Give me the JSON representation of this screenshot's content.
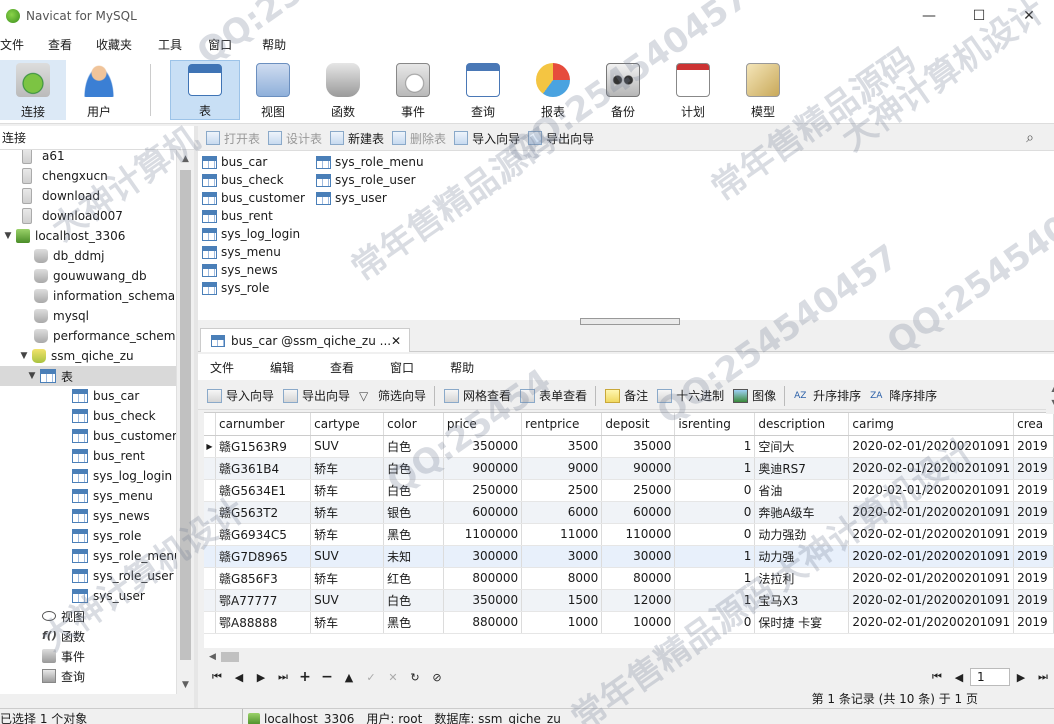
{
  "window": {
    "title": "Navicat for MySQL",
    "controls": [
      "—",
      "☐",
      "✕"
    ]
  },
  "menubar": [
    "文件",
    "查看",
    "收藏夹",
    "工具",
    "窗口",
    "帮助"
  ],
  "toolbar": [
    {
      "label": "连接",
      "icon": "plug-icon"
    },
    {
      "label": "用户",
      "icon": "user-icon"
    },
    {
      "label": "表",
      "icon": "table-icon",
      "active": true
    },
    {
      "label": "视图",
      "icon": "glasses-icon"
    },
    {
      "label": "函数",
      "icon": "function-icon"
    },
    {
      "label": "事件",
      "icon": "clock-icon"
    },
    {
      "label": "查询",
      "icon": "query-icon"
    },
    {
      "label": "报表",
      "icon": "report-icon"
    },
    {
      "label": "备份",
      "icon": "backup-icon"
    },
    {
      "label": "计划",
      "icon": "calendar-icon"
    },
    {
      "label": "模型",
      "icon": "model-icon"
    }
  ],
  "left_panel": {
    "header": "连接",
    "tree": [
      {
        "label": "a61",
        "level": 0,
        "type": "db-plain"
      },
      {
        "label": "chengxucn",
        "level": 0,
        "type": "db-plain"
      },
      {
        "label": "download",
        "level": 0,
        "type": "db-plain"
      },
      {
        "label": "download007",
        "level": 0,
        "type": "db-plain"
      },
      {
        "label": "localhost_3306",
        "level": 0,
        "type": "conn",
        "expander": "▼"
      },
      {
        "label": "db_ddmj",
        "level": 1,
        "type": "db"
      },
      {
        "label": "gouwuwang_db",
        "level": 1,
        "type": "db"
      },
      {
        "label": "information_schema",
        "level": 1,
        "type": "db"
      },
      {
        "label": "mysql",
        "level": 1,
        "type": "db"
      },
      {
        "label": "performance_schema",
        "level": 1,
        "type": "db"
      },
      {
        "label": "ssm_qiche_zu",
        "level": 1,
        "type": "db-open",
        "expander": "▼"
      },
      {
        "label": "表",
        "level": 2,
        "type": "tbl",
        "expander": "▼",
        "selected": true
      },
      {
        "label": "bus_car",
        "level": 3,
        "type": "tbl"
      },
      {
        "label": "bus_check",
        "level": 3,
        "type": "tbl"
      },
      {
        "label": "bus_customer",
        "level": 3,
        "type": "tbl"
      },
      {
        "label": "bus_rent",
        "level": 3,
        "type": "tbl"
      },
      {
        "label": "sys_log_login",
        "level": 3,
        "type": "tbl"
      },
      {
        "label": "sys_menu",
        "level": 3,
        "type": "tbl"
      },
      {
        "label": "sys_news",
        "level": 3,
        "type": "tbl"
      },
      {
        "label": "sys_role",
        "level": 3,
        "type": "tbl"
      },
      {
        "label": "sys_role_menu",
        "level": 3,
        "type": "tbl"
      },
      {
        "label": "sys_role_user",
        "level": 3,
        "type": "tbl"
      },
      {
        "label": "sys_user",
        "level": 3,
        "type": "tbl"
      },
      {
        "label": "视图",
        "level": 2,
        "type": "view"
      },
      {
        "label": "函数",
        "level": 2,
        "type": "fn",
        "glyph": "f()"
      },
      {
        "label": "事件",
        "level": 2,
        "type": "evt"
      },
      {
        "label": "查询",
        "level": 2,
        "type": "qry"
      }
    ]
  },
  "object_toolbar": [
    {
      "label": "打开表",
      "disabled": true
    },
    {
      "label": "设计表",
      "disabled": true
    },
    {
      "label": "新建表",
      "disabled": false
    },
    {
      "label": "删除表",
      "disabled": true
    },
    {
      "label": "导入向导",
      "disabled": false
    },
    {
      "label": "导出向导",
      "disabled": false
    }
  ],
  "object_list": {
    "col1": [
      "bus_car",
      "bus_check",
      "bus_customer",
      "bus_rent",
      "sys_log_login",
      "sys_menu",
      "sys_news",
      "sys_role"
    ],
    "col2": [
      "sys_role_menu",
      "sys_role_user",
      "sys_user"
    ]
  },
  "doc_tab": {
    "label": "bus_car @ssm_qiche_zu ...",
    "close": "✕"
  },
  "inner_menu": [
    "文件",
    "编辑",
    "查看",
    "窗口",
    "帮助"
  ],
  "inner_toolbar": [
    "导入向导",
    "导出向导",
    "筛选向导",
    "网格查看",
    "表单查看",
    "备注",
    "十六进制",
    "图像",
    "升序排序",
    "降序排序"
  ],
  "grid": {
    "columns": [
      "carnumber",
      "cartype",
      "color",
      "price",
      "rentprice",
      "deposit",
      "isrenting",
      "description",
      "carimg",
      "crea"
    ],
    "rows": [
      [
        "赣G1563R9",
        "SUV",
        "白色",
        "350000",
        "3500",
        "35000",
        "1",
        "空间大",
        "2020-02-01/20200201091",
        "2019"
      ],
      [
        "赣G361B4",
        "轿车",
        "白色",
        "900000",
        "9000",
        "90000",
        "1",
        "奥迪RS7",
        "2020-02-01/20200201091",
        "2019"
      ],
      [
        "赣G5634E1",
        "轿车",
        "白色",
        "250000",
        "2500",
        "25000",
        "0",
        "省油",
        "2020-02-01/20200201091",
        "2019"
      ],
      [
        "赣G563T2",
        "轿车",
        "银色",
        "600000",
        "6000",
        "60000",
        "0",
        "奔驰A级车",
        "2020-02-01/20200201091",
        "2019"
      ],
      [
        "赣G6934C5",
        "轿车",
        "黑色",
        "1100000",
        "11000",
        "110000",
        "0",
        "动力强劲",
        "2020-02-01/20200201091",
        "2019"
      ],
      [
        "赣G7D8965",
        "SUV",
        "未知",
        "300000",
        "3000",
        "30000",
        "1",
        "动力强",
        "2020-02-01/20200201091",
        "2019"
      ],
      [
        "赣G856F3",
        "轿车",
        "红色",
        "800000",
        "8000",
        "80000",
        "1",
        "法拉利",
        "2020-02-01/20200201091",
        "2019"
      ],
      [
        "鄂A77777",
        "SUV",
        "白色",
        "350000",
        "1500",
        "12000",
        "1",
        "宝马X3",
        "2020-02-01/20200201091",
        "2019"
      ],
      [
        "鄂A88888",
        "轿车",
        "黑色",
        "880000",
        "1000",
        "10000",
        "0",
        "保时捷 卡宴",
        "2020-02-01/20200201091",
        "2019"
      ]
    ]
  },
  "navigator": {
    "left": [
      "⏮",
      "◀",
      "▶",
      "⏭",
      "+",
      "−",
      "▲",
      "✓",
      "✕",
      "↻",
      "⊘"
    ],
    "right_first": "⏮",
    "right_prev": "◀",
    "page": "1",
    "right_next": "▶",
    "right_last": "⏭"
  },
  "records": "第 1 条记录 (共 10 条) 于 1 页",
  "statusbar": {
    "left": "已选择 1 个对象",
    "connection": "localhost_3306",
    "user": "用户: root",
    "database": "数据库: ssm_qiche_zu"
  },
  "watermarks": [
    "QQ:25454",
    "大神计算机",
    "常年售精品源码",
    "QQ:254540457",
    "大神计算机设计",
    "QQ:25454",
    "常年售精品源码",
    "QQ:254540457",
    "大神计算机设计",
    "常年售精品源码",
    "QQ:254540457",
    "大神计算机设计"
  ]
}
